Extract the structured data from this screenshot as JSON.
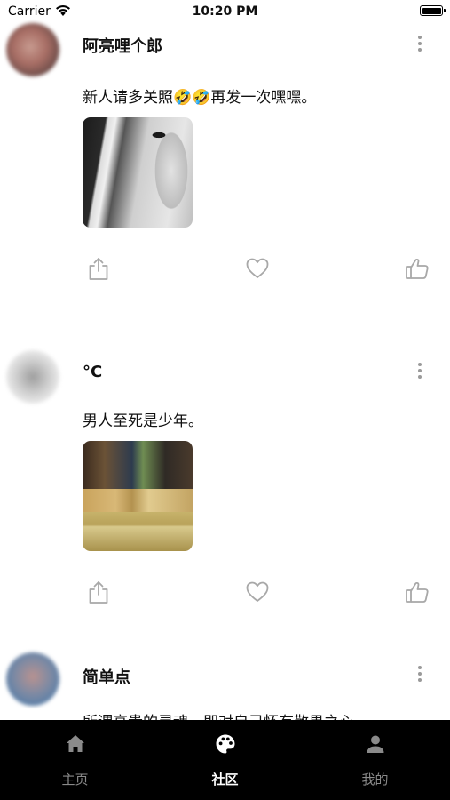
{
  "status_bar": {
    "carrier": "Carrier",
    "time": "10:20 PM"
  },
  "posts": [
    {
      "username": "阿亮哩个郎",
      "text": "新人请多关照🤣🤣再发一次嘿嘿。"
    },
    {
      "username": "°C",
      "text": "男人至死是少年。"
    },
    {
      "username": "简单点",
      "text": "所谓高贵的灵魂，即对自己怀有敬畏之心。"
    }
  ],
  "tabs": [
    {
      "label": "主页",
      "icon": "home-icon",
      "active": false
    },
    {
      "label": "社区",
      "icon": "palette-icon",
      "active": true
    },
    {
      "label": "我的",
      "icon": "person-icon",
      "active": false
    }
  ],
  "colors": {
    "tab_bar_bg": "#000000",
    "tab_active": "#ffffff",
    "tab_inactive": "#8a8a8a",
    "action_icon": "#a8a8a8"
  }
}
